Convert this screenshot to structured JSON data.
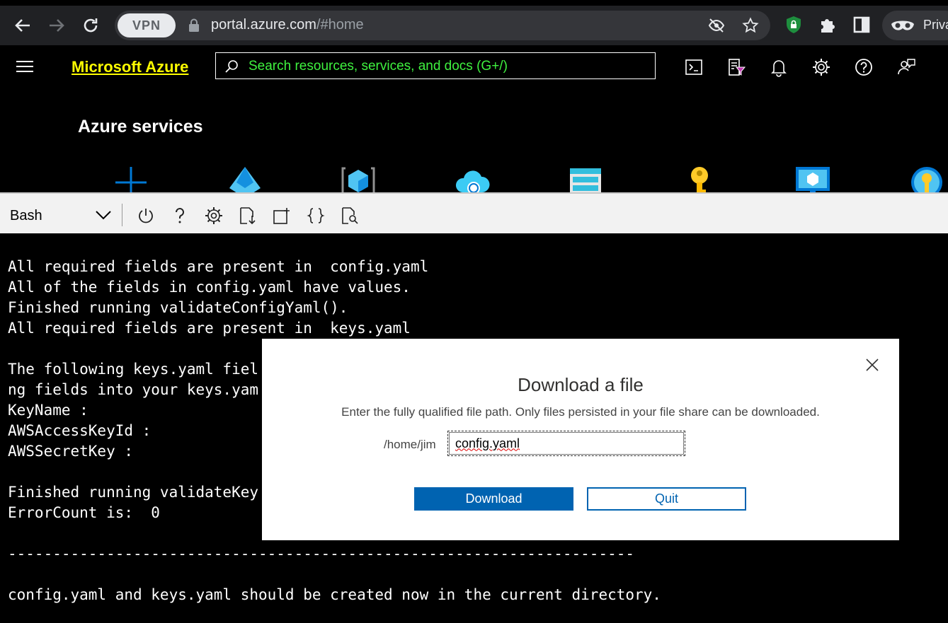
{
  "browser": {
    "vpn_label": "VPN",
    "url_host": "portal.azure.com",
    "url_path": "/#home",
    "private_label": "Priva"
  },
  "header": {
    "brand": "Microsoft Azure",
    "search_placeholder": "Search resources, services, and docs (G+/)"
  },
  "services": {
    "title": "Azure services",
    "icons": [
      "plus-icon",
      "entra-icon",
      "resource-icon",
      "cloud-icon",
      "storage-icon",
      "key-icon",
      "monitor-icon",
      "keyvault-icon"
    ]
  },
  "shell": {
    "selected_shell": "Bash"
  },
  "terminal": {
    "lines": [
      "All required fields are present in  config.yaml",
      "All of the fields in config.yaml have values.",
      "Finished running validateConfigYaml().",
      "All required fields are present in  keys.yaml",
      "",
      "The following keys.yaml fiel                                                     lid va",
      "ng fields into your keys.yam",
      "KeyName :",
      "AWSAccessKeyId :",
      "AWSSecretKey :",
      "",
      "Finished running validateKey",
      "ErrorCount is:  0",
      "",
      "----------------------------------------------------------------------",
      "",
      "config.yaml and keys.yaml should be created now in the current directory."
    ]
  },
  "dialog": {
    "title": "Download a file",
    "description": "Enter the fully qualified file path. Only files persisted in your file share can be downloaded.",
    "path_prefix": "/home/jim",
    "input_value": "config.yaml",
    "download_label": "Download",
    "quit_label": "Quit"
  },
  "colors": {
    "brand_yellow": "#ffff00",
    "search_green": "#3ff23f",
    "primary_blue": "#0063b1"
  }
}
